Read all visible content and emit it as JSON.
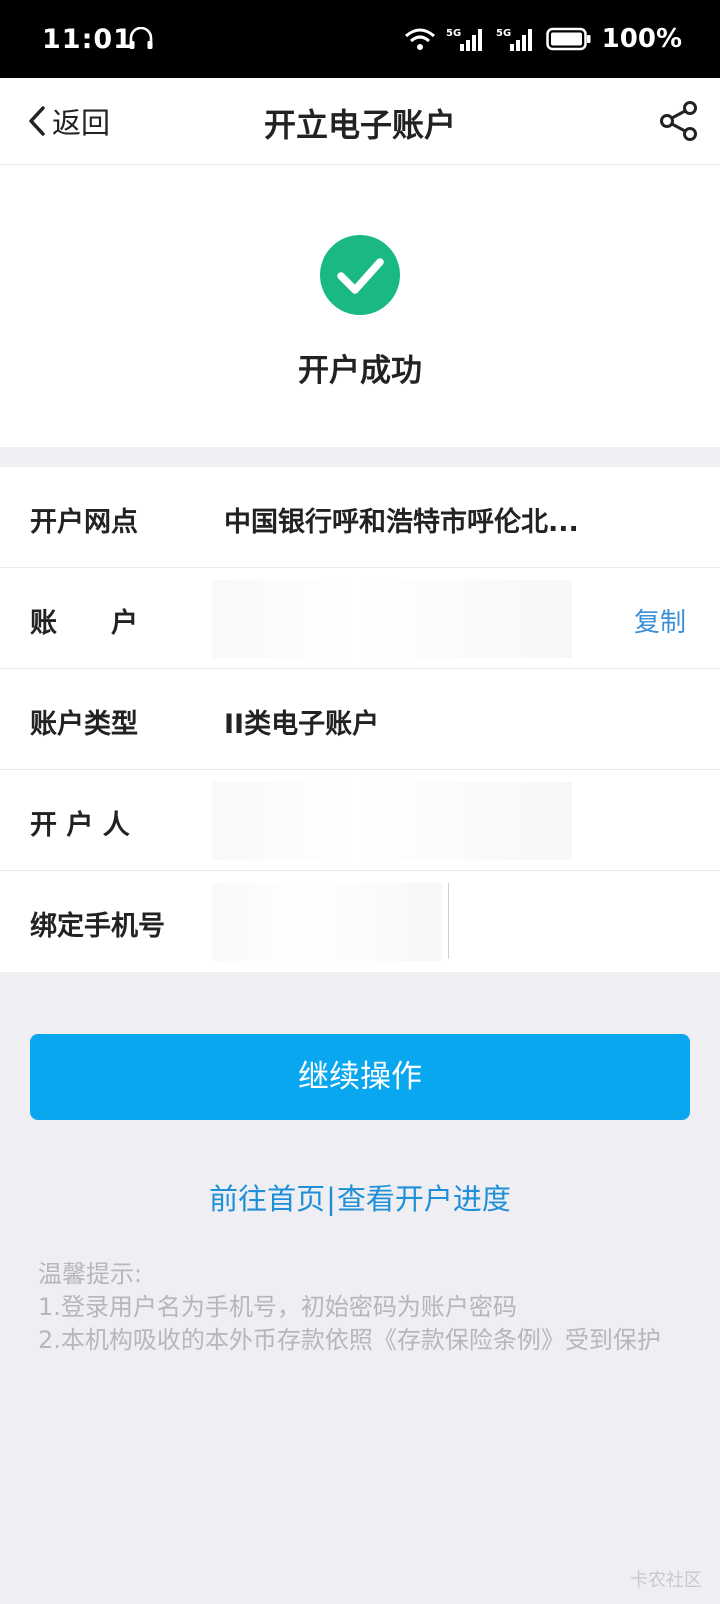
{
  "status_bar": {
    "time": "11:01",
    "battery_pct": "100%",
    "network_1": "5G",
    "network_2": "5G"
  },
  "nav": {
    "back_label": "返回",
    "title": "开立电子账户"
  },
  "success": {
    "title": "开户成功"
  },
  "info": {
    "rows": [
      {
        "label": "开户网点",
        "value": "中国银行呼和浩特市呼伦北..."
      },
      {
        "label": "账　　户",
        "value": "",
        "action": "复制"
      },
      {
        "label": "账户类型",
        "value": "II类电子账户"
      },
      {
        "label": "开 户 人",
        "value": ""
      },
      {
        "label": "绑定手机号",
        "value": ""
      }
    ]
  },
  "actions": {
    "continue_label": "继续操作",
    "home_link": "前往首页",
    "separator": "|",
    "progress_link": "查看开户进度"
  },
  "tips": {
    "heading": "温馨提示:",
    "line1": "1.登录用户名为手机号，初始密码为账户密码",
    "line2": "2.本机构吸收的本外币存款依照《存款保险条例》受到保护"
  },
  "watermark": "卡农社区",
  "colors": {
    "accent": "#09a7ef",
    "success": "#19b981",
    "link": "#1f8fd8"
  }
}
